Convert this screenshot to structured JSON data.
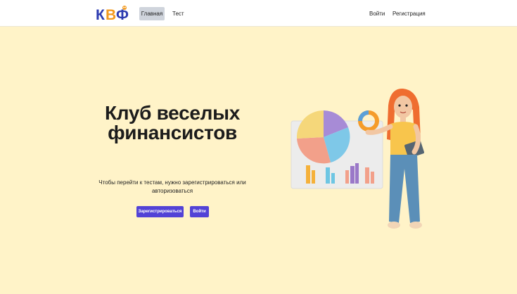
{
  "navbar": {
    "logo_text": "КВФ",
    "links": {
      "home": "Главная",
      "test": "Тест",
      "login": "Войти",
      "register": "Регистрация"
    }
  },
  "hero": {
    "title": "Клуб веселых финансистов",
    "subtitle": "Чтобы перейти к тестам, нужно зарегистрироваться или авторизоваться",
    "buttons": {
      "register": "Зарегистрироваться",
      "login": "Войти"
    },
    "illustration_icon": "woman-with-tablet-and-charts-illustration"
  },
  "colors": {
    "navbar_bg": "#ffffff",
    "hero_bg": "#fff3c8",
    "accent": "#5242d6",
    "active_nav_bg": "#cfd4dc"
  }
}
